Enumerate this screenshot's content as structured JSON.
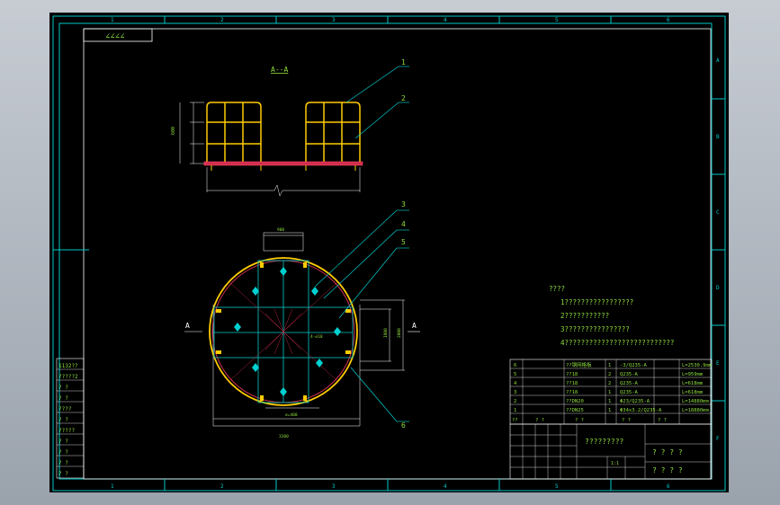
{
  "drawing": {
    "section_label": "A--A",
    "section_mark_left": "A",
    "section_mark_right": "A",
    "corner_marks": "∠∠∠∠",
    "column_numbers": [
      "1",
      "2",
      "3",
      "4",
      "5",
      "6"
    ],
    "row_letters": [
      "A",
      "B",
      "C",
      "D",
      "E",
      "F"
    ],
    "callouts": [
      "1",
      "2",
      "3",
      "4",
      "5",
      "6"
    ],
    "dimensions": {
      "width_top": "900",
      "overall": "3200",
      "mid": "1800",
      "side": "2000",
      "height": "600",
      "ring": "∅=400",
      "phi": "4-∅18"
    }
  },
  "notes": {
    "title": "????",
    "items": [
      "1?????????????????",
      "2???????????",
      "3????????????????",
      "4???????????????????????????"
    ]
  },
  "bom": {
    "rows": [
      [
        "6",
        "??钢网格板",
        "1",
        "-3/Q235-A",
        "L=2530.9mm"
      ],
      [
        "5",
        "??18",
        "2",
        "Q235-A",
        "L=959mm"
      ],
      [
        "4",
        "??18",
        "2",
        "Q235-A",
        "L=618mm"
      ],
      [
        "3",
        "??18",
        "1",
        "Q235-A",
        "L=618mm"
      ],
      [
        "2",
        "??DN20",
        "1",
        "Φ23/Q235-A",
        "L=14880mm"
      ],
      [
        "1",
        "??DN25",
        "1",
        "Φ34x3.2/Q235-A",
        "L=18880mm"
      ]
    ],
    "header": [
      "??",
      "? ?",
      "? ?",
      "? ?",
      "? ?"
    ],
    "title_block": {
      "drawing_name": "?????????",
      "company_1": "? ? ? ?",
      "company_2": "? ? ? ?",
      "scale_label": "1:1"
    }
  },
  "left_strip": [
    "1132??",
    "?????2",
    "? ?",
    "? ?",
    "????",
    "? ?",
    "?????",
    "? ?",
    "? ?",
    "? ?",
    "? ?"
  ]
}
